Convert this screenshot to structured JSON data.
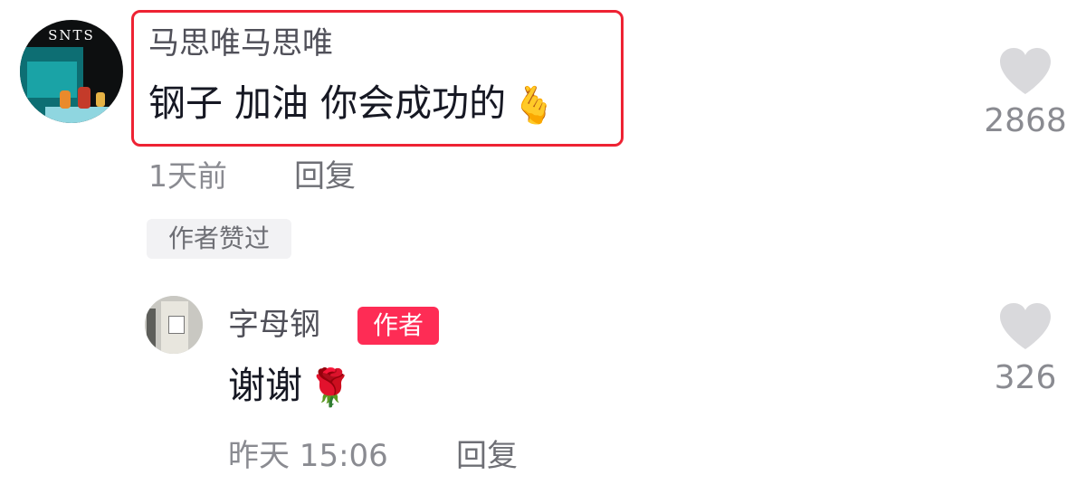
{
  "comment": {
    "username": "马思唯马思唯",
    "text": "钢子 加油 你会成功的",
    "emoji": "🫰",
    "time": "1天前",
    "reply_label": "回复",
    "liked_badge": "作者赞过",
    "like_count": "2868",
    "avatar_text": "SNTS"
  },
  "reply": {
    "username": "字母钢",
    "author_badge": "作者",
    "text": "谢谢",
    "emoji": "🌹",
    "time": "昨天 15:06",
    "reply_label": "回复",
    "like_count": "326"
  },
  "colors": {
    "highlight_border": "#ee2233",
    "author_badge_bg": "#fe2c55",
    "like_icon": "#d9d9dc"
  }
}
